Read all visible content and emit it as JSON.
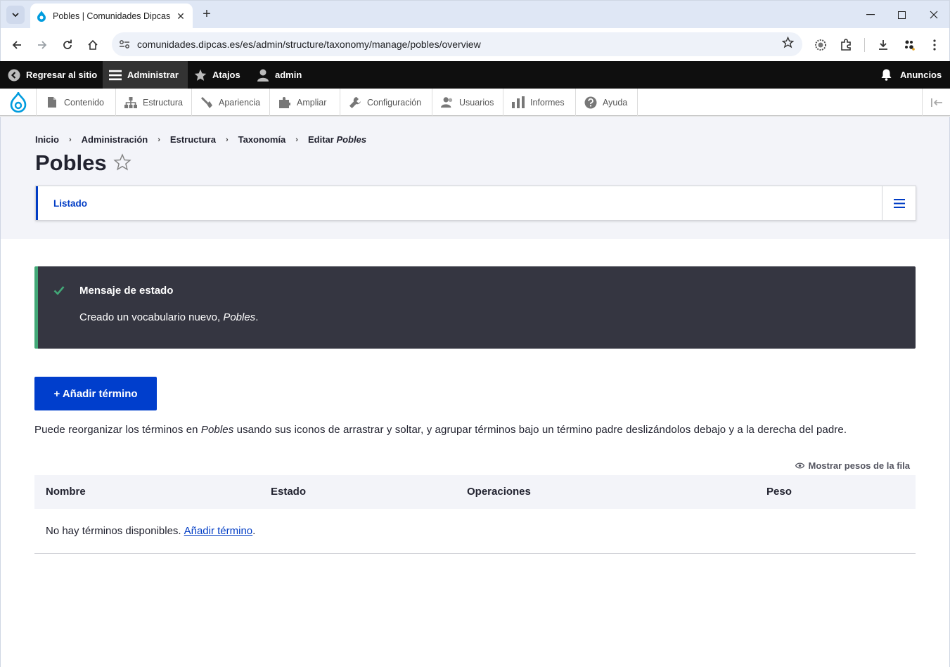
{
  "browser": {
    "tab_title": "Pobles | Comunidades Dipcas",
    "url": "comunidades.dipcas.es/es/admin/structure/taxonomy/manage/pobles/overview",
    "new_tab": "+",
    "close_tab": "✕"
  },
  "toolbar": {
    "back_to_site": "Regresar al sitio",
    "manage": "Administrar",
    "shortcuts": "Atajos",
    "user": "admin",
    "announcements": "Anuncios"
  },
  "tray": {
    "items": [
      {
        "label": "Contenido",
        "icon": "file-icon"
      },
      {
        "label": "Estructura",
        "icon": "sitemap-icon"
      },
      {
        "label": "Apariencia",
        "icon": "brush-icon"
      },
      {
        "label": "Ampliar",
        "icon": "puzzle-icon"
      },
      {
        "label": "Configuración",
        "icon": "wrench-icon"
      },
      {
        "label": "Usuarios",
        "icon": "people-icon"
      },
      {
        "label": "Informes",
        "icon": "bar-chart-icon"
      },
      {
        "label": "Ayuda",
        "icon": "help-icon"
      }
    ]
  },
  "breadcrumb": {
    "items": [
      "Inicio",
      "Administración",
      "Estructura",
      "Taxonomía"
    ],
    "last_prefix": "Editar",
    "last_em": "Pobles",
    "separator": "›"
  },
  "page": {
    "title": "Pobles",
    "tab_label": "Listado"
  },
  "status": {
    "title": "Mensaje de estado",
    "text_prefix": "Creado un vocabulario nuevo,",
    "text_em": "Pobles",
    "text_suffix": "."
  },
  "actions": {
    "add_term": "+ Añadir término"
  },
  "help": {
    "prefix": "Puede reorganizar los términos en",
    "em": "Pobles",
    "suffix": "usando sus iconos de arrastrar y soltar, y agrupar términos bajo un término padre deslizándolos debajo y a la derecha del padre."
  },
  "table": {
    "show_weights": "Mostrar pesos de la fila",
    "headers": [
      "Nombre",
      "Estado",
      "Operaciones",
      "Peso"
    ],
    "empty_text": "No hay términos disponibles.",
    "empty_link": "Añadir término",
    "empty_suffix": "."
  },
  "colors": {
    "accent": "#003ecc",
    "status_bg": "#353641",
    "status_border": "#42a877",
    "drupal_blue": "#009cde"
  }
}
